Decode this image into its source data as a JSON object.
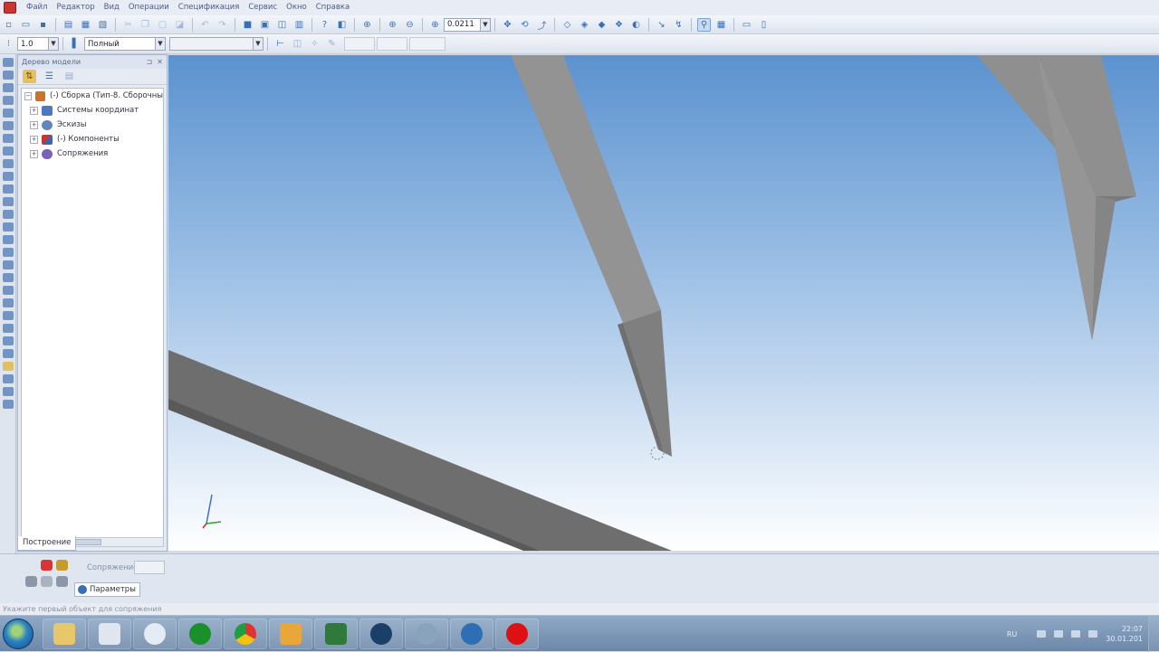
{
  "menubar": {
    "items": [
      "Файл",
      "Редактор",
      "Вид",
      "Операции",
      "Спецификация",
      "Сервис",
      "Окно",
      "Справка"
    ]
  },
  "toolbar": {
    "zoom_value": "0.0211",
    "line_width": "1.0",
    "display_mode": "Полный"
  },
  "tree": {
    "title": "Дерево модели",
    "root_label": "(-) Сборка (Тип-8. Сборочны",
    "items": [
      {
        "label": "Системы координат",
        "icon": "coordinate-system-icon"
      },
      {
        "label": "Эскизы",
        "icon": "sketch-icon"
      },
      {
        "label": "(-) Компоненты",
        "icon": "components-icon"
      },
      {
        "label": "Сопряжения",
        "icon": "constraints-icon"
      }
    ],
    "tab_label": "Построение"
  },
  "property_panel": {
    "field_label": "Сопряжение",
    "params_tab": "Параметры"
  },
  "status": {
    "text": "Укажите первый объект для сопряжения"
  },
  "taskbar": {
    "lang": "RU",
    "time": "22:07",
    "date": "30.01.201"
  },
  "viewport": {
    "background_top": "#5b92cf",
    "background_bottom": "#ffffff",
    "beam_color": "#8a8a8a"
  }
}
